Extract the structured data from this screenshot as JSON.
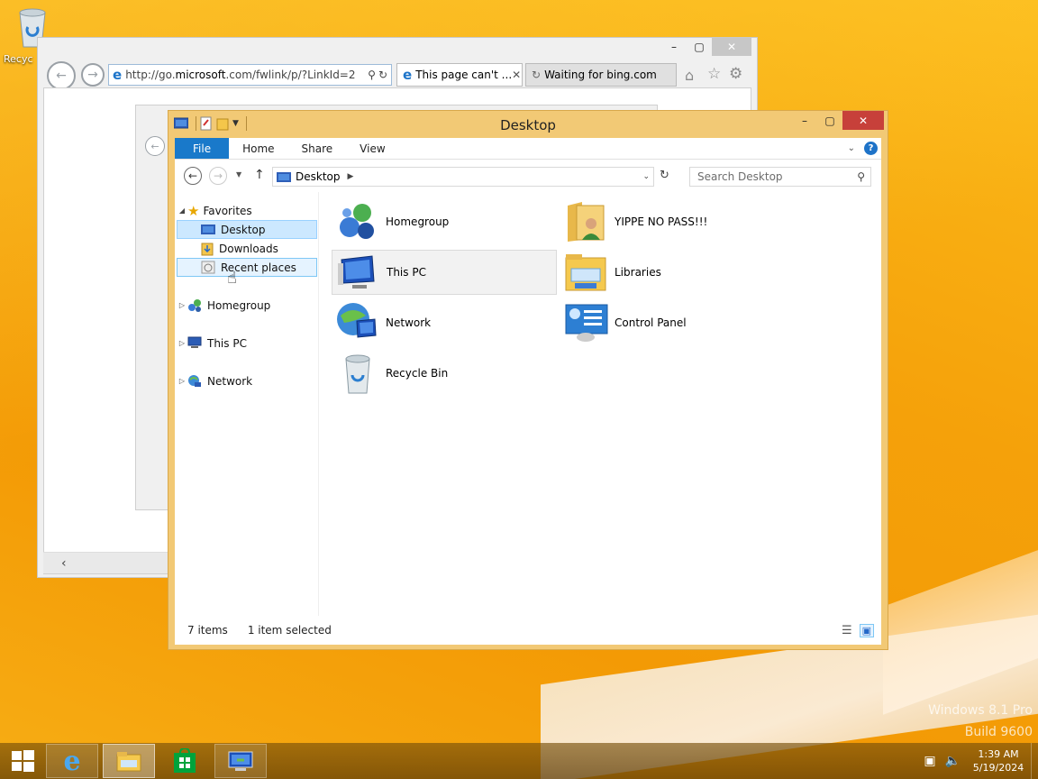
{
  "desktop": {
    "recycle_label": "Recyc",
    "watermark_line1": "Windows 8.1 Pro",
    "watermark_line2": "Build 9600"
  },
  "ie": {
    "url_prefix": "http://go.",
    "url_domain": "microsoft",
    "url_suffix": ".com/fwlink/p/?LinkId=2",
    "tab1_title": "This page can't ...",
    "tab2_title": "Waiting for bing.com"
  },
  "explorer": {
    "title": "Desktop",
    "ribbon_tabs": [
      "File",
      "Home",
      "Share",
      "View"
    ],
    "address": "Desktop",
    "search_placeholder": "Search Desktop",
    "nav": {
      "favorites": "Favorites",
      "desktop": "Desktop",
      "downloads": "Downloads",
      "recent": "Recent places",
      "homegroup": "Homegroup",
      "thispc": "This PC",
      "network": "Network"
    },
    "items": {
      "homegroup": "Homegroup",
      "yippe": "YIPPE NO PASS!!!",
      "thispc": "This PC",
      "libraries": "Libraries",
      "network": "Network",
      "controlpanel": "Control Panel",
      "recyclebin": "Recycle Bin"
    },
    "status_count": "7 items",
    "status_selected": "1 item selected"
  },
  "taskbar": {
    "time": "1:39 AM",
    "date": "5/19/2024"
  },
  "colors": {
    "accent": "#1979ca",
    "frame": "#f2c975",
    "close": "#c7403a",
    "desktop": "#f5a800"
  }
}
